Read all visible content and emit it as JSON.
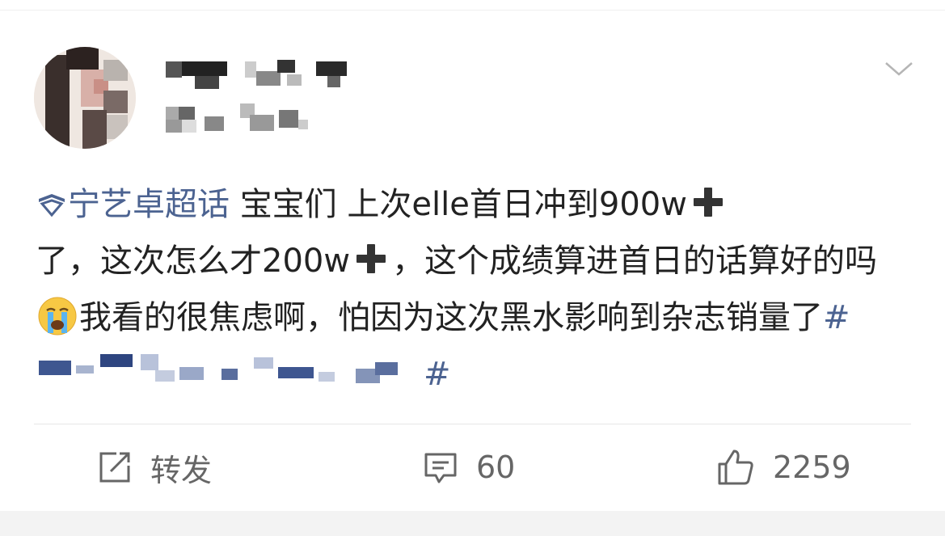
{
  "post": {
    "topic_label": "宁艺卓超话",
    "text_part1": " 宝宝们 上次elle首日冲到900w",
    "text_part2": "了，这次怎么才200w",
    "text_part3": "，这个成绩算进首日的话算好的吗",
    "text_part4": "我看的很焦虑啊，怕因为这次黑水影响到杂志销量了",
    "hashtag_open": "#",
    "hashtag_close": "#"
  },
  "actions": {
    "repost_label": "转发",
    "comment_count": "60",
    "like_count": "2259"
  },
  "icons": {
    "more": "chevron-down-icon",
    "topic": "topic-icon",
    "plus": "heavy-plus-icon",
    "cry": "loudly-crying-face-icon",
    "repost": "repost-icon",
    "comment": "comment-icon",
    "like": "thumbs-up-icon"
  },
  "colors": {
    "link": "#4c6391",
    "text": "#222222",
    "muted": "#666666"
  }
}
